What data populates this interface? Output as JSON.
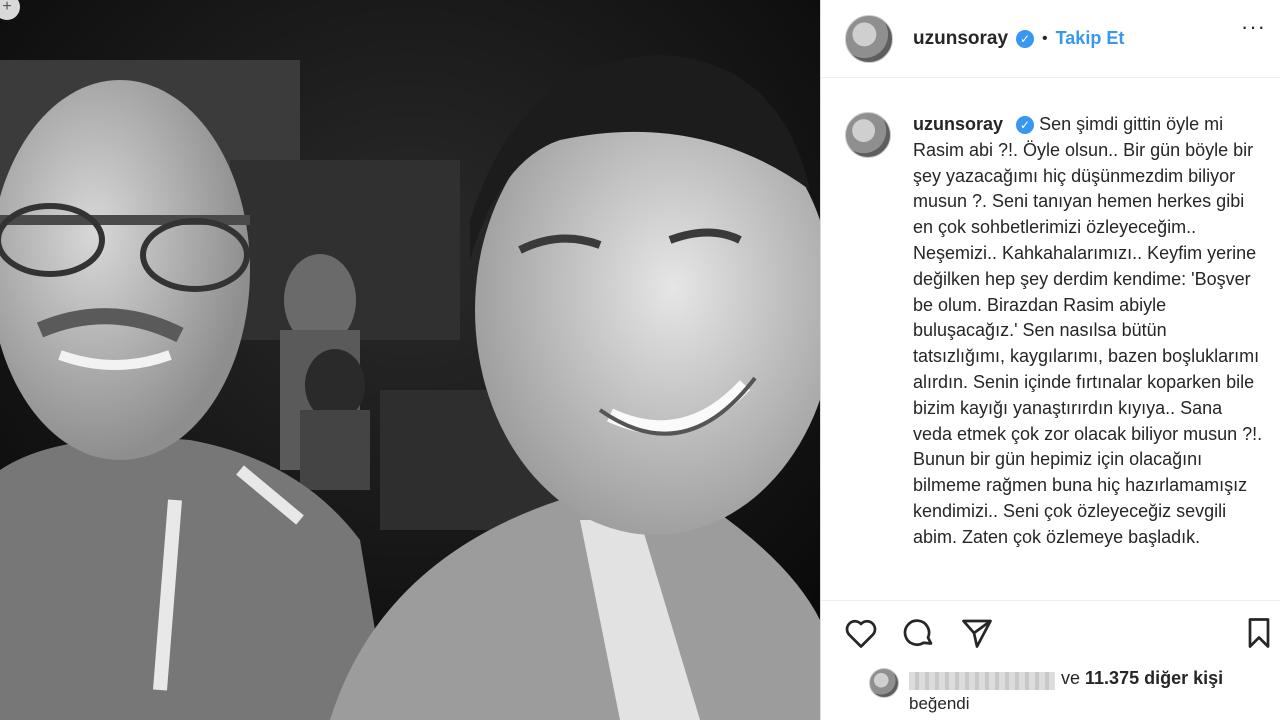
{
  "header": {
    "username": "uzunsoray",
    "separator": "•",
    "follow_label": "Takip Et",
    "more_label": "···"
  },
  "caption": {
    "username": "uzunsoray",
    "text": "Sen şimdi gittin öyle mi Rasim abi ?!. Öyle olsun.. Bir gün böyle bir şey yazacağımı hiç düşünmezdim biliyor musun ?. Seni tanıyan hemen herkes gibi en çok sohbetlerimizi özleyeceğim.. Neşemizi.. Kahkahalarımızı.. Keyfim yerine değilken hep şey derdim kendime: 'Boşver be olum. Birazdan Rasim abiyle buluşacağız.' Sen nasılsa bütün tatsızlığımı, kaygılarımı, bazen boşluklarımı alırdın. Senin içinde fırtınalar koparken bile bizim kayığı yanaştırırdın kıyıya.. Sana veda etmek çok zor olacak biliyor musun ?!. Bunun bir gün hepimiz için olacağını bilmeme rağmen buna hiç hazırlamamışız kendimizi.. Seni çok özleyeceğiz sevgili abim. Zaten çok özlemeye başladık."
  },
  "likes": {
    "connector": "ve",
    "others": "11.375 diğer kişi",
    "liked_label": "beğendi"
  },
  "icons": {
    "like": "heart-icon",
    "comment": "comment-icon",
    "share": "paper-plane-icon",
    "save": "bookmark-icon",
    "verified": "verified-badge-icon"
  },
  "colors": {
    "accent": "#3897f0",
    "text": "#262626",
    "border": "#dbdbdb"
  }
}
